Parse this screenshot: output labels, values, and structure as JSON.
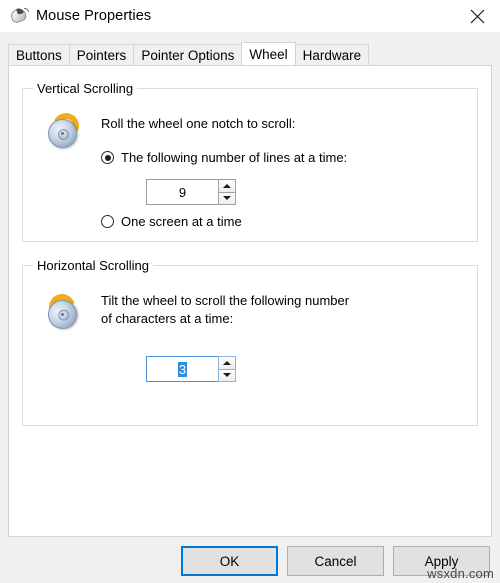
{
  "window": {
    "title": "Mouse Properties",
    "icon": "mouse-icon",
    "close_label": "✕"
  },
  "tabs": [
    {
      "label": "Buttons",
      "active": false
    },
    {
      "label": "Pointers",
      "active": false
    },
    {
      "label": "Pointer Options",
      "active": false
    },
    {
      "label": "Wheel",
      "active": true
    },
    {
      "label": "Hardware",
      "active": false
    }
  ],
  "vertical_scrolling": {
    "group_title": "Vertical Scrolling",
    "icon": "mouse-wheel-vertical-icon",
    "lead_text": "Roll the wheel one notch to scroll:",
    "option_lines": {
      "label": "The following number of lines at a time:",
      "selected": true
    },
    "lines_spinner": {
      "value": "9",
      "up_icon": "chevron-up-icon",
      "down_icon": "chevron-down-icon"
    },
    "option_screen": {
      "label": "One screen at a time",
      "selected": false
    }
  },
  "horizontal_scrolling": {
    "group_title": "Horizontal Scrolling",
    "icon": "mouse-wheel-horizontal-icon",
    "lead_line1": "Tilt the wheel to scroll the following number",
    "lead_line2": "of characters at a time:",
    "chars_spinner": {
      "value": "3",
      "focused": true,
      "text_selected": true,
      "up_icon": "chevron-up-icon",
      "down_icon": "chevron-down-icon"
    }
  },
  "footer": {
    "ok_label": "OK",
    "cancel_label": "Cancel",
    "apply_label": "Apply"
  },
  "watermark": {
    "text": "wsxdn.com"
  },
  "colors": {
    "accent_blue": "#0078d7",
    "selection_blue": "#2f8fe0",
    "wheel_orange": "#f0ab1e",
    "panel_bg": "#ffffff",
    "dialog_bg": "#f0f0f0"
  }
}
